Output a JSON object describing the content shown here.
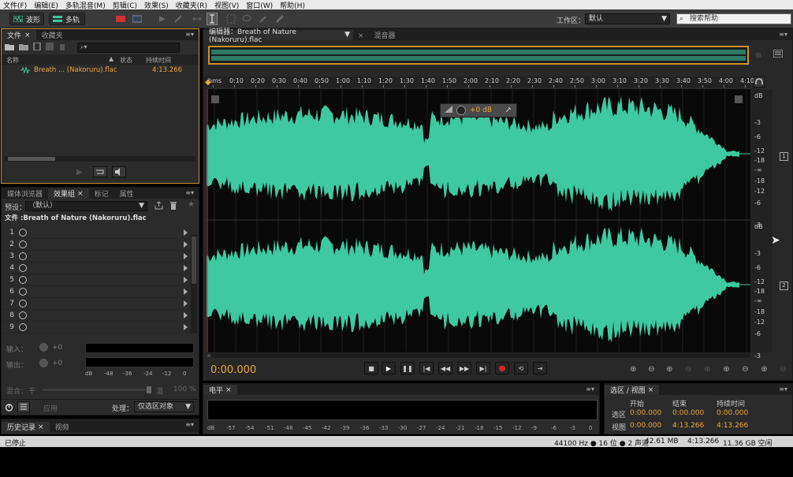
{
  "menu": [
    "文件(F)",
    "编辑(E)",
    "多轨混音(M)",
    "剪辑(C)",
    "效果(S)",
    "收藏夹(R)",
    "视图(V)",
    "窗口(W)",
    "帮助(H)"
  ],
  "toolbar": {
    "waveform_label": "波形",
    "multitrack_label": "多轨",
    "workspace_label": "工作区：",
    "workspace_value": "默认",
    "search_placeholder": "搜索帮助"
  },
  "files_panel": {
    "tabs": [
      "文件",
      "收藏夹"
    ],
    "columns": {
      "name": "名称",
      "status": "状态",
      "duration": "持续时间"
    },
    "items": [
      {
        "name": "Breath ... (Nakoruru).flac",
        "duration": "4:13.266"
      }
    ]
  },
  "effects_panel": {
    "tabs": [
      "媒体浏览器",
      "效果组",
      "标记",
      "属性"
    ],
    "preset_label": "预设：",
    "preset_value": "（默认）",
    "file_label": "文件 :Breath of Nature (Nakoruru).flac",
    "slots": [
      "1",
      "2",
      "3",
      "4",
      "5",
      "6",
      "7",
      "8",
      "9"
    ],
    "input_label": "输入：",
    "output_label": "输出：",
    "input_value": "+0",
    "output_value": "+0",
    "mix_label": "混合：",
    "mix_dry": "干",
    "mix_wet": "湿",
    "mix_value": "100 %",
    "scale": [
      "dB",
      "-48",
      "-36",
      "-24",
      "-12",
      "0"
    ],
    "apply_label": "应用",
    "process_label": "处理：",
    "process_value": "仅选区对象"
  },
  "history_panel": {
    "tabs": [
      "历史记录",
      "视频"
    ]
  },
  "editor": {
    "tabs": [
      "编辑器：Breath of Nature (Nakoruru).flac",
      "混音器"
    ],
    "time_ticks": [
      "hms",
      "0:10",
      "0:20",
      "0:30",
      "0:40",
      "0:50",
      "1:00",
      "1:10",
      "1:20",
      "1:30",
      "1:40",
      "1:50",
      "2:00",
      "2:10",
      "2:20",
      "2:30",
      "2:40",
      "2:50",
      "3:00",
      "3:10",
      "3:20",
      "3:30",
      "3:40",
      "3:50",
      "4:00",
      "4:10"
    ],
    "db_scale_top": [
      "dB",
      "-3",
      "-6",
      "-12",
      "-18",
      "-∞",
      "-18",
      "-12",
      "-6",
      "-3"
    ],
    "db_scale_bottom": [
      "dB",
      "-3",
      "-6",
      "-12",
      "-18",
      "-∞",
      "-18",
      "-12",
      "-6",
      "-3"
    ],
    "channel_badges": [
      "1",
      "2"
    ],
    "hud_gain": "+0 dB",
    "current_time": "0:00.000",
    "waveform_color": "#3ec9a0",
    "accent_color": "#e8a637"
  },
  "levels_panel": {
    "tab": "电平",
    "scale": [
      "dB",
      "-57",
      "-54",
      "-51",
      "-48",
      "-45",
      "-42",
      "-39",
      "-36",
      "-33",
      "-30",
      "-27",
      "-24",
      "-21",
      "-18",
      "-15",
      "-12",
      "-9",
      "-6",
      "-3",
      "0"
    ]
  },
  "selection_panel": {
    "tab": "选区 / 视图",
    "headers": [
      "开始",
      "结束",
      "持续时间"
    ],
    "rows": [
      {
        "label": "选区",
        "start": "0:00.000",
        "end": "0:00.000",
        "duration": "0:00.000"
      },
      {
        "label": "视图",
        "start": "0:00.000",
        "end": "4:13.266",
        "duration": "4:13.266"
      }
    ]
  },
  "status": {
    "state": "已停止",
    "format": "44100 Hz ● 16 位 ● 2 声道",
    "size": "42.61 MB",
    "duration": "4:13.266",
    "free": "11.36 GB 空闲"
  }
}
